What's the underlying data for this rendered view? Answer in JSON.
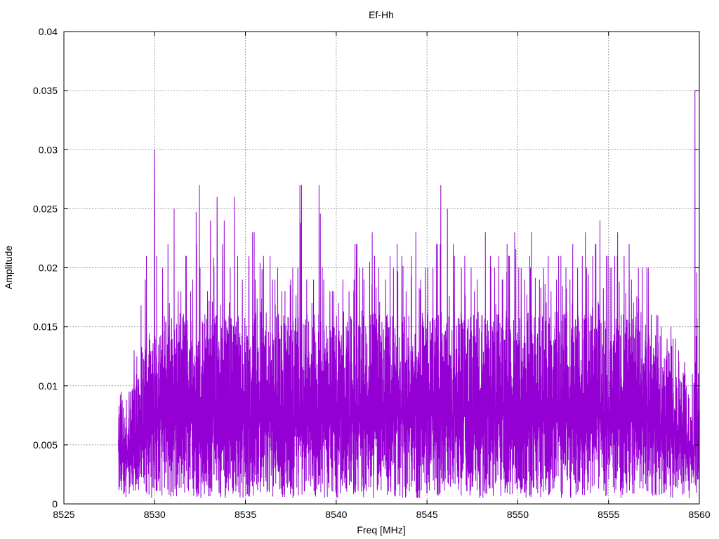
{
  "chart_data": {
    "type": "line",
    "title": "Ef-Hh",
    "xlabel": "Freq [MHz]",
    "ylabel": "Amplitude",
    "xlim": [
      8525,
      8560
    ],
    "ylim": [
      0,
      0.04
    ],
    "xticks": [
      "8525",
      "8530",
      "8535",
      "8540",
      "8545",
      "8550",
      "8555",
      "8560"
    ],
    "yticks": [
      "0",
      "0.005",
      "0.01",
      "0.015",
      "0.02",
      "0.025",
      "0.03",
      "0.035",
      "0.04"
    ],
    "grid": true,
    "legend": "none",
    "color": "#9400D3",
    "series": [
      {
        "name": "Ef-Hh",
        "note_bins": "per-bin peak amplitude envelope, 0.25 MHz bins",
        "x_start": 8528,
        "bin_width": 0.25,
        "max": [
          0.0095,
          0.0088,
          0.0095,
          0.013,
          0.0125,
          0.019,
          0.021,
          0.03,
          0.021,
          0.02,
          0.022,
          0.017,
          0.025,
          0.018,
          0.021,
          0.018,
          0.019,
          0.027,
          0.02,
          0.018,
          0.024,
          0.026,
          0.022,
          0.024,
          0.02,
          0.026,
          0.021,
          0.019,
          0.021,
          0.023,
          0.019,
          0.021,
          0.02,
          0.021,
          0.019,
          0.02,
          0.018,
          0.019,
          0.02,
          0.02,
          0.027,
          0.019,
          0.017,
          0.019,
          0.027,
          0.019,
          0.018,
          0.018,
          0.017,
          0.019,
          0.018,
          0.019,
          0.022,
          0.02,
          0.019,
          0.023,
          0.021,
          0.02,
          0.019,
          0.021,
          0.02,
          0.022,
          0.021,
          0.018,
          0.021,
          0.023,
          0.019,
          0.02,
          0.02,
          0.02,
          0.022,
          0.027,
          0.025,
          0.022,
          0.021,
          0.02,
          0.021,
          0.02,
          0.018,
          0.019,
          0.023,
          0.021,
          0.02,
          0.021,
          0.019,
          0.022,
          0.021,
          0.023,
          0.02,
          0.019,
          0.021,
          0.023,
          0.019,
          0.02,
          0.021,
          0.018,
          0.019,
          0.021,
          0.02,
          0.019,
          0.022,
          0.02,
          0.023,
          0.02,
          0.021,
          0.022,
          0.024,
          0.021,
          0.02,
          0.021,
          0.023,
          0.021,
          0.022,
          0.019,
          0.02,
          0.02,
          0.02,
          0.016,
          0.016,
          0.015,
          0.014,
          0.015,
          0.014,
          0.013,
          0.012,
          0.01,
          0.011,
          0.035
        ],
        "min": 0.0005
      }
    ]
  }
}
